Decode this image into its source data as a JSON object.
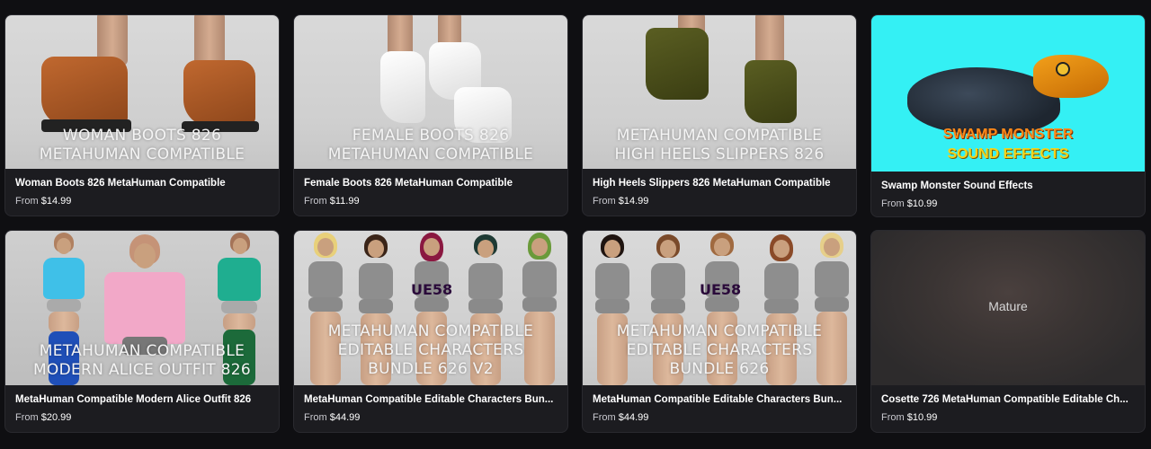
{
  "cards": [
    {
      "title": "Woman Boots 826 MetaHuman Compatible",
      "price_prefix": "From",
      "price": "$14.99",
      "overlay": [
        "WOMAN BOOTS 826",
        "METAHUMAN COMPATIBLE"
      ]
    },
    {
      "title": "Female Boots 826 MetaHuman Compatible",
      "price_prefix": "From",
      "price": "$11.99",
      "overlay": [
        "FEMALE BOOTS 826",
        "METAHUMAN COMPATIBLE"
      ]
    },
    {
      "title": "High Heels Slippers 826 MetaHuman Compatible",
      "price_prefix": "From",
      "price": "$14.99",
      "overlay": [
        "METAHUMAN COMPATIBLE",
        "HIGH HEELS SLIPPERS 826"
      ]
    },
    {
      "title": "Swamp Monster Sound Effects",
      "price_prefix": "From",
      "price": "$10.99",
      "overlay": [
        "SWAMP MONSTER",
        "SOUND EFFECTS"
      ]
    },
    {
      "title": "MetaHuman Compatible Modern Alice Outfit 826",
      "price_prefix": "From",
      "price": "$20.99",
      "overlay": [
        "METAHUMAN COMPATIBLE",
        "MODERN ALICE OUTFIT 826"
      ]
    },
    {
      "title": "MetaHuman Compatible Editable Characters Bun...",
      "price_prefix": "From",
      "price": "$44.99",
      "badge": "UE58",
      "overlay": [
        "METAHUMAN COMPATIBLE",
        "EDITABLE CHARACTERS",
        "BUNDLE 626 V2"
      ]
    },
    {
      "title": "MetaHuman Compatible Editable Characters Bun...",
      "price_prefix": "From",
      "price": "$44.99",
      "badge": "UE58",
      "overlay": [
        "METAHUMAN COMPATIBLE",
        "EDITABLE CHARACTERS",
        "BUNDLE 626"
      ]
    },
    {
      "title": "Cosette 726 MetaHuman Compatible Editable Ch...",
      "price_prefix": "From",
      "price": "$10.99",
      "mature_label": "Mature"
    }
  ]
}
